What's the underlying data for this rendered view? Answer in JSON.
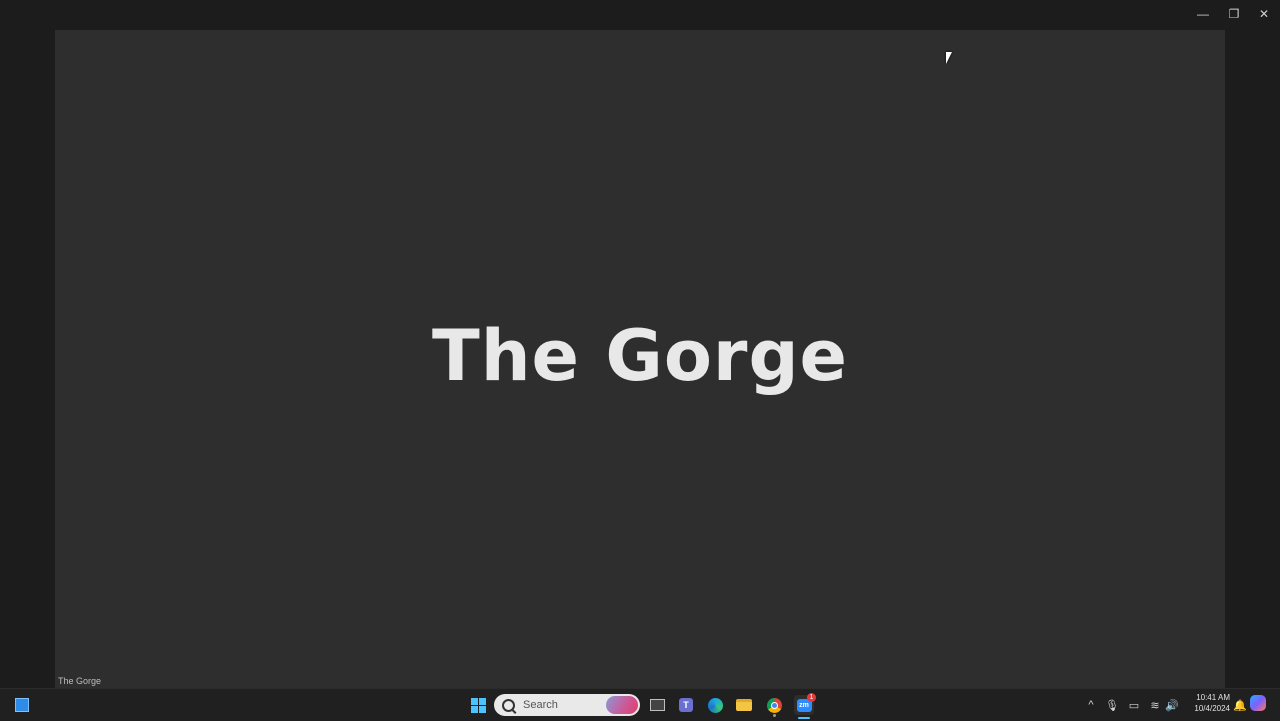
{
  "window": {
    "controls": {
      "minimize": "—",
      "maximize": "❐",
      "close": "✕"
    }
  },
  "slide": {
    "title": "The Gorge",
    "caption": "The Gorge"
  },
  "taskbar": {
    "search_placeholder": "Search",
    "zoom_badge": "1",
    "teams_label": "T",
    "zoom_label": "zm",
    "tray": {
      "chevron": "^",
      "mic": "🎙",
      "display": "▭",
      "wifi": "≋",
      "volume": "🔊",
      "notify": "🔔"
    },
    "clock": {
      "time": "10:41 AM",
      "date": "10/4/2024"
    }
  }
}
